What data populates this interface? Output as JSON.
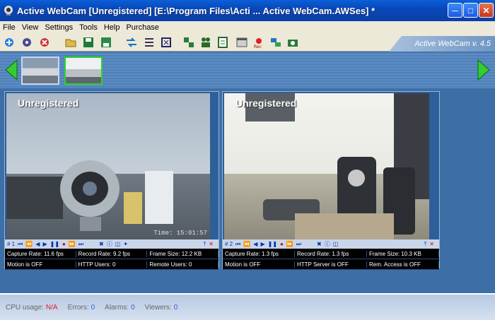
{
  "window": {
    "title": "Active WebCam [Unregistered] [E:\\Program Files\\Acti ... Active WebCam.AWSes] *"
  },
  "menu": [
    "File",
    "View",
    "Settings",
    "Tools",
    "Help",
    "Purchase"
  ],
  "version": "Active WebCam v. 4.5",
  "toolbar_icons": [
    "add-camera-icon",
    "camera-settings-icon",
    "remove-camera-icon",
    "open-icon",
    "save-icon",
    "save-as-icon",
    "connect-icon",
    "list-icon",
    "fullscreen-icon",
    "layout-icon",
    "users-icon",
    "schedule-icon",
    "calendar-icon",
    "record-icon",
    "network-icon",
    "snapshot-icon"
  ],
  "cameras": [
    {
      "overlay": "Unregistered",
      "timestamp": "Time: 15:01:57",
      "number": "# 1",
      "stats": {
        "capture_rate": "Capture Rate: 11.6 fps",
        "record_rate": "Record Rate: 9.2 fps",
        "frame_size": "Frame Size: 12.2 KB",
        "motion": "Motion is OFF",
        "http": "HTTP Users: 0",
        "remote": "Remote Users: 0"
      }
    },
    {
      "overlay": "Unregistered",
      "number": "# 2",
      "stats": {
        "capture_rate": "Capture Rate: 1.3 fps",
        "record_rate": "Record Rate: 1.3 fps",
        "frame_size": "Frame Size: 10.3 KB",
        "motion": "Motion is OFF",
        "http": "HTTP Server is OFF",
        "remote": "Rem. Access is OFF"
      }
    }
  ],
  "status": {
    "cpu_label": "CPU usage:",
    "cpu_value": "N/A",
    "errors_label": "Errors:",
    "errors_value": "0",
    "alarms_label": "Alarms:",
    "alarms_value": "0",
    "viewers_label": "Viewers:",
    "viewers_value": "0"
  },
  "colors": {
    "accent": "#0a5fd8",
    "workspace": "#3d6ea6",
    "thumb_selected": "#29d629",
    "cpu_value": "#e21d1d"
  }
}
